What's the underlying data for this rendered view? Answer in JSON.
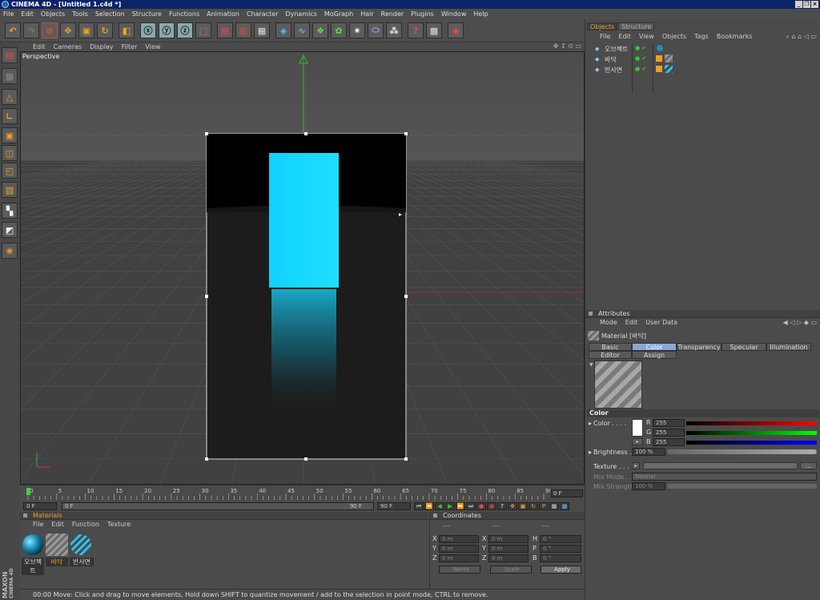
{
  "app": {
    "title": "CINEMA 4D - [Untitled 1.c4d *]"
  },
  "menu": [
    "File",
    "Edit",
    "Objects",
    "Tools",
    "Selection",
    "Structure",
    "Functions",
    "Animation",
    "Character",
    "Dynamics",
    "MoGraph",
    "Hair",
    "Render",
    "Plugins",
    "Window",
    "Help"
  ],
  "viewport": {
    "menu": [
      "Edit",
      "Cameras",
      "Display",
      "Filter",
      "View"
    ],
    "label": "Perspective",
    "colors": {
      "grid_bg": "#3f3f3f",
      "render_top": "#000000",
      "render_floor": "#1c1c1c",
      "cyan": "#14d8ff"
    }
  },
  "timeline": {
    "ticks": [
      "0",
      "5",
      "10",
      "15",
      "20",
      "25",
      "30",
      "35",
      "40",
      "45",
      "50",
      "55",
      "60",
      "65",
      "70",
      "75",
      "80",
      "85",
      "90"
    ],
    "frame_field": "0 F",
    "start_field": "0 F",
    "range_start": "0 F",
    "range_end": "90 F",
    "end_field": "90 F"
  },
  "materials": {
    "title": "Materials",
    "menu": [
      "File",
      "Edit",
      "Function",
      "Texture"
    ],
    "items": [
      {
        "label": "오브젝트",
        "type": "sphere"
      },
      {
        "label": "바닥",
        "type": "stripes"
      },
      {
        "label": "반사면",
        "type": "sphere-stripes"
      }
    ]
  },
  "coordinates": {
    "title": "Coordinates",
    "col_heads": [
      "---",
      "---",
      "---"
    ],
    "rows": [
      {
        "a": "X",
        "av": "0 m",
        "b": "X",
        "bv": "0 m",
        "c": "H",
        "cv": "0 °"
      },
      {
        "a": "Y",
        "av": "0 m",
        "b": "Y",
        "bv": "0 m",
        "c": "P",
        "cv": "0 °"
      },
      {
        "a": "Z",
        "av": "0 m",
        "b": "Z",
        "bv": "0 m",
        "c": "B",
        "cv": "0 °"
      }
    ],
    "space_select": "World",
    "scale_select": "Scale",
    "apply": "Apply"
  },
  "status": {
    "text": "00:00  Move: Click and drag to move elements, Hold down SHIFT to quantize movement / add to the selection in point mode, CTRL to remove."
  },
  "logo": {
    "line1": "MAXON",
    "line2": "CINEMA 4D"
  },
  "objects_panel": {
    "tabs": [
      "Objects",
      "Structure"
    ],
    "menu": [
      "File",
      "Edit",
      "View",
      "Objects",
      "Tags",
      "Bookmarks"
    ],
    "items": [
      "오브젝트",
      "바닥",
      "반사면"
    ]
  },
  "attributes": {
    "title": "Attributes",
    "menu": [
      "Mode",
      "Edit",
      "User Data"
    ],
    "material_name": "Material [바닥]",
    "tabs": [
      "Basic",
      "Color",
      "Transparency",
      "Specular",
      "Illumination",
      "Editor",
      "Assign"
    ],
    "active_tab": "Color",
    "section": "Color",
    "color_label": "Color . . . .",
    "r_label": "R",
    "r": "255",
    "g_label": "G",
    "g": "255",
    "b_label": "B",
    "b": "255",
    "brightness_label": "Brightness . .",
    "brightness": "100 %",
    "texture_label": "Texture . . . .",
    "texture_btn": "...",
    "mixmode_label": "Mix Mode . . .",
    "mixmode": "Normal",
    "mixstrength_label": "Mix Strength",
    "mixstrength": "100 %"
  }
}
